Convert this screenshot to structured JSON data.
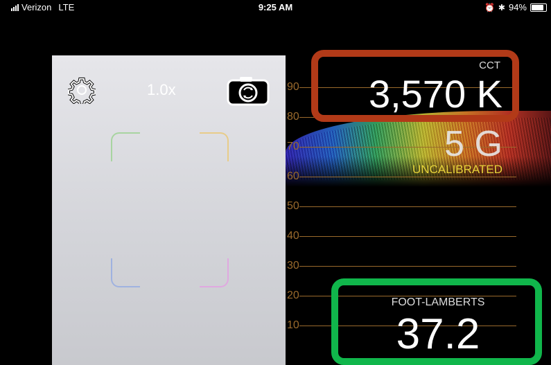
{
  "status_bar": {
    "carrier": "Verizon",
    "network": "LTE",
    "time": "9:25 AM",
    "battery": "94%",
    "battery_level": 0.94
  },
  "camera": {
    "zoom": "1.0x",
    "settings_icon": "gear-icon",
    "switch_icon": "camera-switch-icon"
  },
  "graph": {
    "ticks": [
      "90",
      "80",
      "70",
      "60",
      "50",
      "40",
      "30",
      "20",
      "10"
    ]
  },
  "readings": {
    "cct_label": "CCT",
    "cct_value": "3,570 K",
    "tint_value": "5 G",
    "calibration": "UNCALIBRATED",
    "fl_label": "FOOT-LAMBERTS",
    "fl_value": "37.2"
  },
  "colors": {
    "cct_highlight": "#b23a18",
    "fl_highlight": "#10b64b",
    "calibration_text": "#e6d23a",
    "grid_line": "#9a6a2c"
  }
}
